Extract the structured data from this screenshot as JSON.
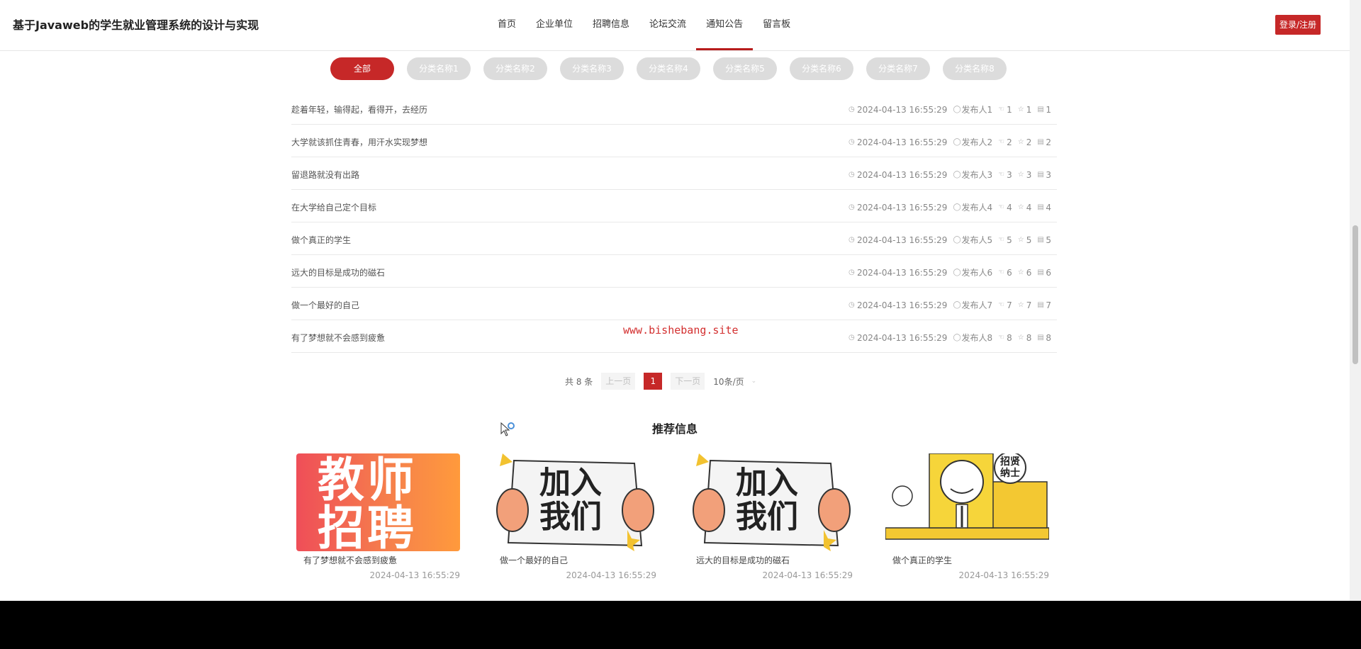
{
  "header": {
    "site_title": "基于Javaweb的学生就业管理系统的设计与实现",
    "nav": [
      "首页",
      "企业单位",
      "招聘信息",
      "论坛交流",
      "通知公告",
      "留言板"
    ],
    "active_nav": "通知公告",
    "login_label": "登录/注册"
  },
  "categories": [
    "全部",
    "分类名称1",
    "分类名称2",
    "分类名称3",
    "分类名称4",
    "分类名称5",
    "分类名称6",
    "分类名称7",
    "分类名称8"
  ],
  "active_category": "全部",
  "list": [
    {
      "title": "趁着年轻，输得起，看得开，去经历",
      "date": "2024-04-13 16:55:29",
      "author": "发布人1",
      "likes": "1",
      "favs": "1",
      "comments": "1"
    },
    {
      "title": "大学就该抓住青春，用汗水实现梦想",
      "date": "2024-04-13 16:55:29",
      "author": "发布人2",
      "likes": "2",
      "favs": "2",
      "comments": "2"
    },
    {
      "title": "留退路就没有出路",
      "date": "2024-04-13 16:55:29",
      "author": "发布人3",
      "likes": "3",
      "favs": "3",
      "comments": "3"
    },
    {
      "title": "在大学给自己定个目标",
      "date": "2024-04-13 16:55:29",
      "author": "发布人4",
      "likes": "4",
      "favs": "4",
      "comments": "4"
    },
    {
      "title": "做个真正的学生",
      "date": "2024-04-13 16:55:29",
      "author": "发布人5",
      "likes": "5",
      "favs": "5",
      "comments": "5"
    },
    {
      "title": "远大的目标是成功的磁石",
      "date": "2024-04-13 16:55:29",
      "author": "发布人6",
      "likes": "6",
      "favs": "6",
      "comments": "6"
    },
    {
      "title": "做一个最好的自己",
      "date": "2024-04-13 16:55:29",
      "author": "发布人7",
      "likes": "7",
      "favs": "7",
      "comments": "7"
    },
    {
      "title": "有了梦想就不会感到疲惫",
      "date": "2024-04-13 16:55:29",
      "author": "发布人8",
      "likes": "8",
      "favs": "8",
      "comments": "8"
    }
  ],
  "watermark": "www.bishebang.site",
  "pagination": {
    "total": "共 8 条",
    "prev": "上一页",
    "current": "1",
    "next": "下一页",
    "page_size": "10条/页"
  },
  "recommend": {
    "title": "推荐信息",
    "cards": [
      {
        "image_text": "教师招聘",
        "title": "有了梦想就不会感到疲惫",
        "date": "2024-04-13 16:55:29"
      },
      {
        "image_text": "加入我们",
        "title": "做一个最好的自己",
        "date": "2024-04-13 16:55:29"
      },
      {
        "image_text": "加入我们",
        "title": "远大的目标是成功的磁石",
        "date": "2024-04-13 16:55:29"
      },
      {
        "image_text": "招贤纳士",
        "title": "做个真正的学生",
        "date": "2024-04-13 16:55:29"
      }
    ]
  },
  "colors": {
    "accent": "#c62828",
    "category_inactive": "#dcdcdc"
  }
}
